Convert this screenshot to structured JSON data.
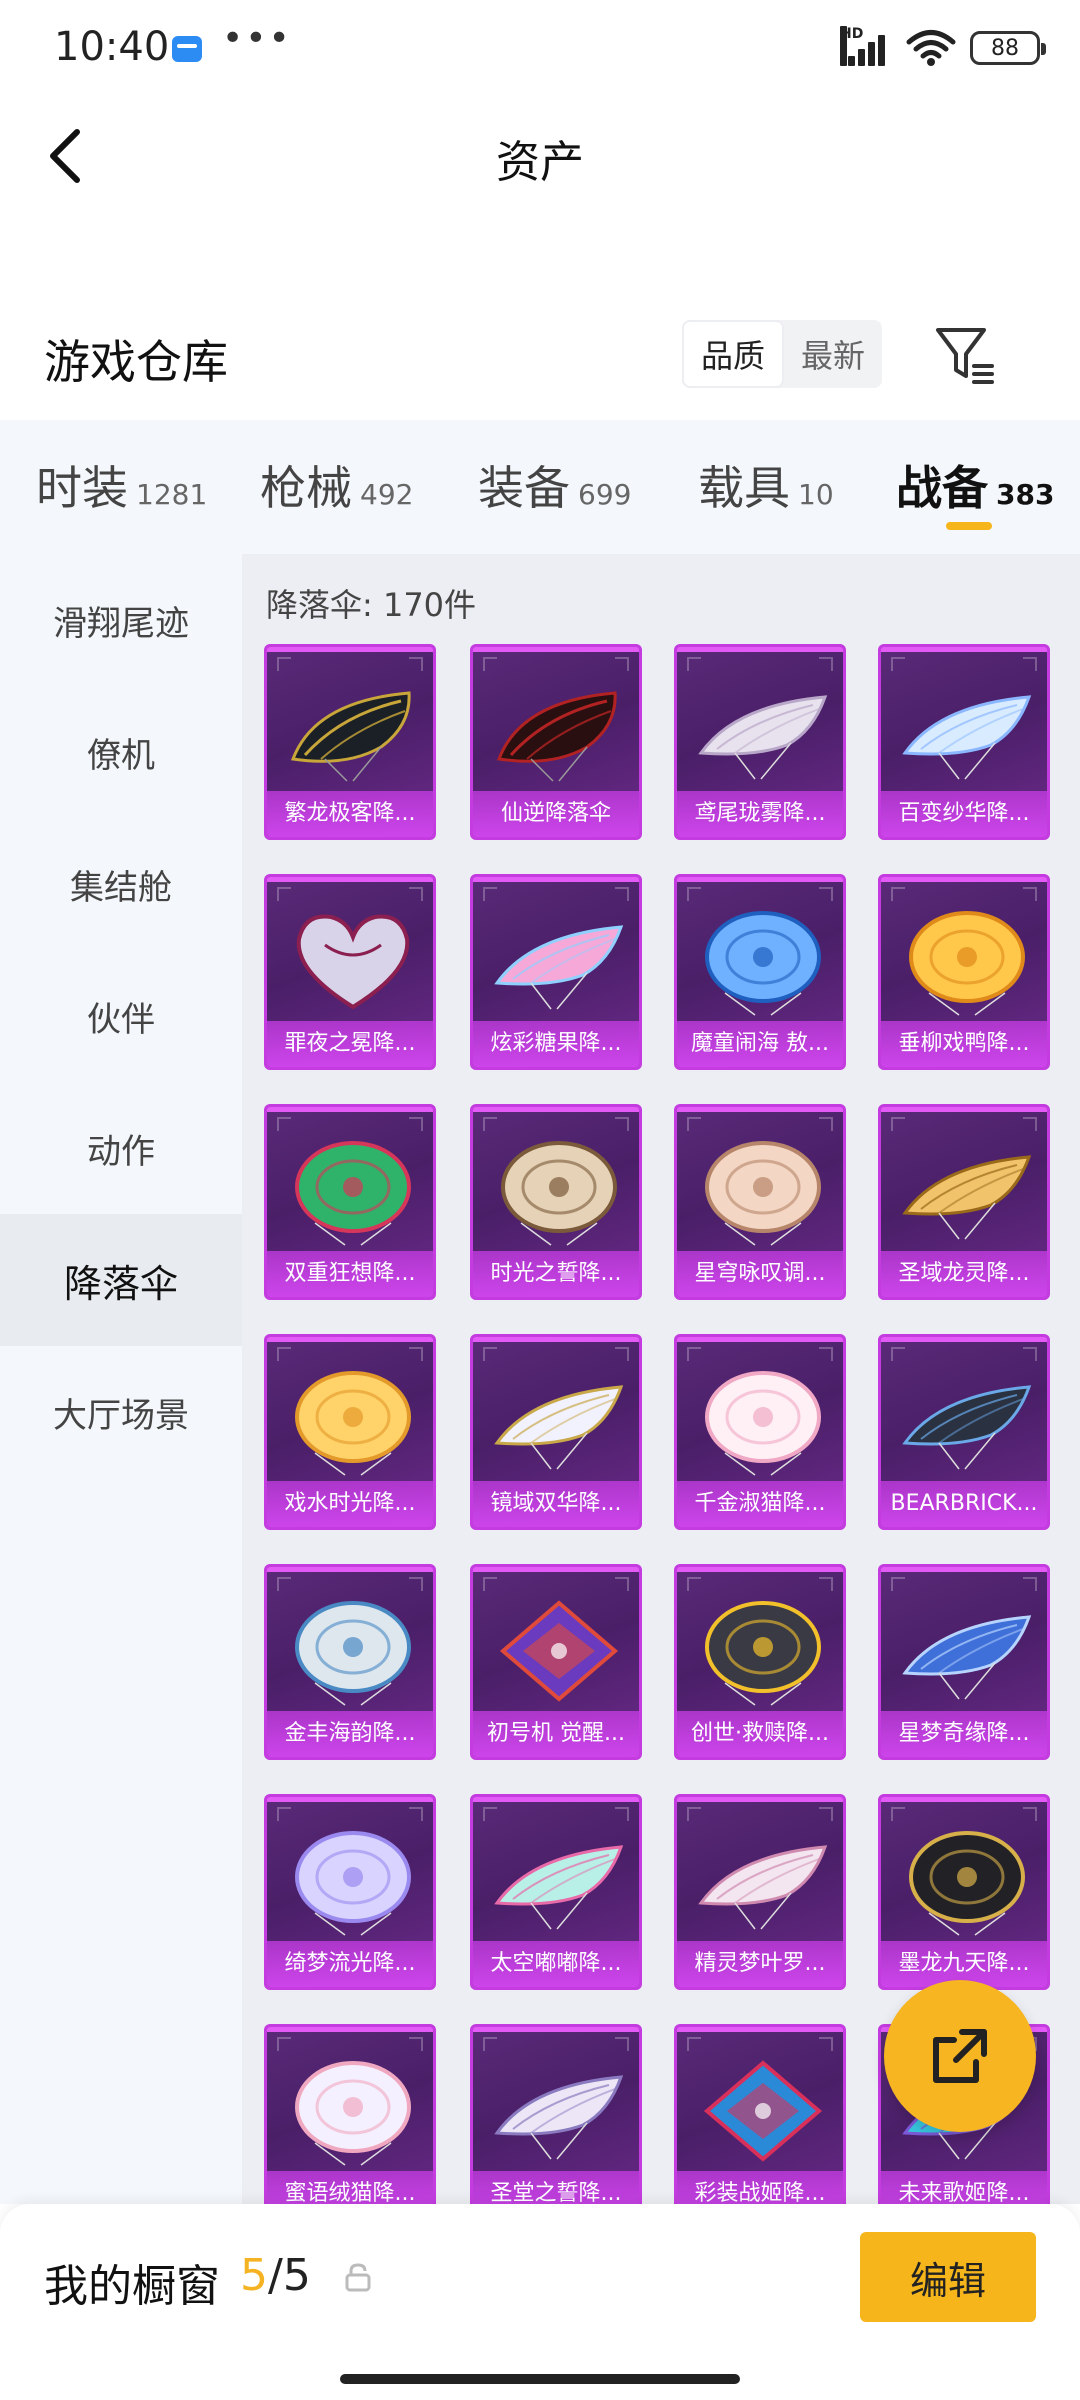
{
  "status_bar": {
    "time": "10:40",
    "more": "•••",
    "network_label": "HD",
    "battery": "88"
  },
  "header": {
    "title": "资产"
  },
  "warehouse": {
    "title": "游戏仓库",
    "sort_options": [
      "品质",
      "最新"
    ],
    "active_sort": "品质"
  },
  "tabs": [
    {
      "label": "时装",
      "count": "1281"
    },
    {
      "label": "枪械",
      "count": "492"
    },
    {
      "label": "装备",
      "count": "699"
    },
    {
      "label": "载具",
      "count": "10"
    },
    {
      "label": "战备",
      "count": "383"
    }
  ],
  "active_tab": "战备",
  "side_nav": [
    "滑翔尾迹",
    "僚机",
    "集结舱",
    "伙伴",
    "动作",
    "降落伞",
    "大厅场景"
  ],
  "active_side": "降落伞",
  "content": {
    "count_label": "降落伞: 170件",
    "items": [
      {
        "name": "繁龙极客降...",
        "art": "dark-wing",
        "c1": "#1b2026",
        "c2": "#c9a63a"
      },
      {
        "name": "仙逆降落伞",
        "art": "dark-wing",
        "c1": "#2a0f10",
        "c2": "#b22222"
      },
      {
        "name": "鸢尾珑雾降...",
        "art": "wing",
        "c1": "#e8e2ee",
        "c2": "#b9a7c9"
      },
      {
        "name": "百变纱华降...",
        "art": "wing",
        "c1": "#d9ecff",
        "c2": "#8ab7ff"
      },
      {
        "name": "罪夜之冕降...",
        "art": "heart",
        "c1": "#d8d3e8",
        "c2": "#8b1f4f"
      },
      {
        "name": "炫彩糖果降...",
        "art": "wing",
        "c1": "#f6a9d8",
        "c2": "#8fd0ff"
      },
      {
        "name": "魔童闹海 敖...",
        "art": "round",
        "c1": "#6fb1ff",
        "c2": "#1f5fbf"
      },
      {
        "name": "垂柳戏鸭降...",
        "art": "round",
        "c1": "#ffc84a",
        "c2": "#e08a1a"
      },
      {
        "name": "双重狂想降...",
        "art": "round",
        "c1": "#2fb36a",
        "c2": "#d6365a"
      },
      {
        "name": "时光之誓降...",
        "art": "round",
        "c1": "#e6d2b6",
        "c2": "#7a5a3a"
      },
      {
        "name": "星穹咏叹调...",
        "art": "round",
        "c1": "#f3d6c4",
        "c2": "#b7866a"
      },
      {
        "name": "圣域龙灵降...",
        "art": "wing",
        "c1": "#f1c36a",
        "c2": "#9a6a1a"
      },
      {
        "name": "戏水时光降...",
        "art": "round",
        "c1": "#ffd36a",
        "c2": "#e49a2a"
      },
      {
        "name": "镜域双华降...",
        "art": "wing",
        "c1": "#f2f2ff",
        "c2": "#c9a84a"
      },
      {
        "name": "千金淑猫降...",
        "art": "round",
        "c1": "#fff0f5",
        "c2": "#f0a8c4"
      },
      {
        "name": "BEARBRICK...",
        "art": "wing",
        "c1": "#2a3140",
        "c2": "#6aa8e8"
      },
      {
        "name": "金丰海韵降...",
        "art": "round",
        "c1": "#dfe7ee",
        "c2": "#4a8ac4"
      },
      {
        "name": "初号机 觉醒...",
        "art": "diamond",
        "c1": "#6a3bbf",
        "c2": "#e04a3a"
      },
      {
        "name": "创世·救赎降...",
        "art": "round",
        "c1": "#3a3a44",
        "c2": "#f2c02a"
      },
      {
        "name": "星梦奇缘降...",
        "art": "wing",
        "c1": "#3f6fd8",
        "c2": "#b7d4ff"
      },
      {
        "name": "绮梦流光降...",
        "art": "round",
        "c1": "#d9d4ff",
        "c2": "#9a8af0"
      },
      {
        "name": "太空嘟嘟降...",
        "art": "wing",
        "c1": "#b8f0e8",
        "c2": "#e86aa8"
      },
      {
        "name": "精灵梦叶罗...",
        "art": "wing",
        "c1": "#f3e6f0",
        "c2": "#d08ab0"
      },
      {
        "name": "墨龙九天降...",
        "art": "round",
        "c1": "#222226",
        "c2": "#d8b04a"
      },
      {
        "name": "蜜语绒猫降...",
        "art": "round",
        "c1": "#f4f0ff",
        "c2": "#f0a8c0"
      },
      {
        "name": "圣堂之誓降...",
        "art": "wing",
        "c1": "#ece6f6",
        "c2": "#8a7ac0"
      },
      {
        "name": "彩装战姬降...",
        "art": "diamond",
        "c1": "#2a8ad8",
        "c2": "#d8305a"
      },
      {
        "name": "未来歌姬降...",
        "art": "wing",
        "c1": "#38c8e0",
        "c2": "#7a5ad8"
      }
    ]
  },
  "bottom_bar": {
    "label": "我的橱窗",
    "current": "5",
    "separator": "/",
    "max": "5",
    "edit_label": "编辑"
  },
  "colors": {
    "accent": "#f6b51a",
    "card_border": "#c43ce0",
    "card_bg": "#4a1f68"
  }
}
